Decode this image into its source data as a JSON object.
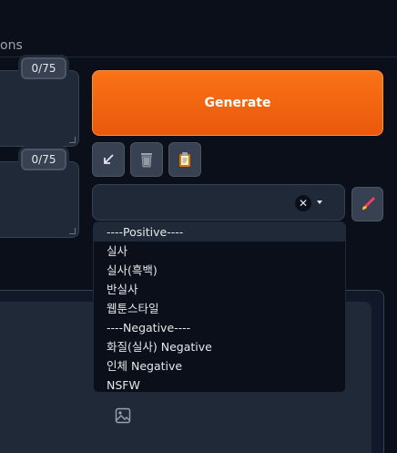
{
  "tabs": {
    "partial_label": "ons"
  },
  "prompts": [
    {
      "token_count": "0/75"
    },
    {
      "token_count": "0/75"
    }
  ],
  "generate": {
    "label": "Generate"
  },
  "tools": [
    {
      "icon": "arrow-icon"
    },
    {
      "icon": "trash-icon"
    },
    {
      "icon": "clipboard-icon"
    }
  ],
  "styles": {
    "selected_value": "",
    "clear_symbol": "✕",
    "options": [
      "----Positive----",
      "실사",
      "실사(흑백)",
      "반실사",
      "웹툰스타일",
      "----Negative----",
      "화질(실사) Negative",
      "인체 Negative",
      "NSFW"
    ]
  },
  "colors": {
    "accent": "#f97316",
    "background": "#0b0f19",
    "panel": "#1f2937"
  }
}
